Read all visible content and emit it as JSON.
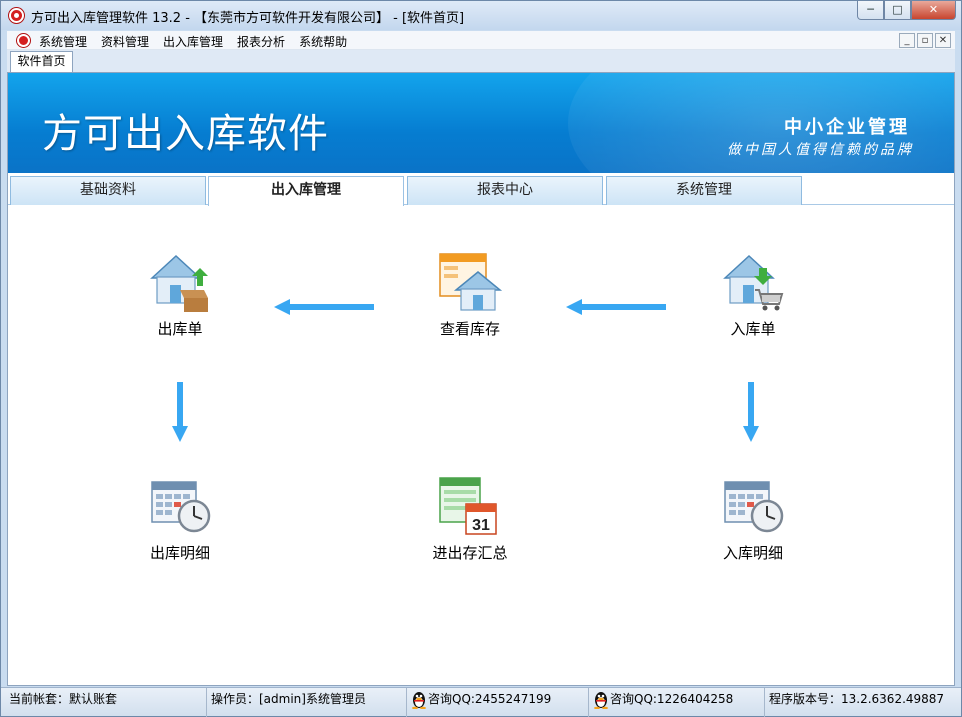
{
  "window": {
    "title": "方可出入库管理软件 13.2 - 【东莞市方可软件开发有限公司】 - [软件首页]",
    "buttons": [
      "─",
      "□",
      "✕"
    ]
  },
  "menubar": {
    "items": [
      "系统管理",
      "资料管理",
      "出入库管理",
      "报表分析",
      "系统帮助"
    ],
    "mdi_buttons": [
      "_",
      "▫",
      "✕"
    ]
  },
  "doc_tab": {
    "label": "软件首页"
  },
  "banner": {
    "title": "方可出入库软件",
    "subtitle": "中小企业管理",
    "slogan": "做中国人值得信赖的品牌"
  },
  "module_tabs": [
    {
      "label": "基础资料",
      "active": false
    },
    {
      "label": "出入库管理",
      "active": true
    },
    {
      "label": "报表中心",
      "active": false
    },
    {
      "label": "系统管理",
      "active": false
    }
  ],
  "tiles": {
    "outbound_order": {
      "label": "出库单",
      "icon": "house-box-icon"
    },
    "view_stock": {
      "label": "查看库存",
      "icon": "window-house-icon"
    },
    "inbound_order": {
      "label": "入库单",
      "icon": "house-cart-icon"
    },
    "outbound_detail": {
      "label": "出库明细",
      "icon": "calendar-clock-icon"
    },
    "summary": {
      "label": "进出存汇总",
      "icon": "calendar-31-icon",
      "day": "31"
    },
    "inbound_detail": {
      "label": "入库明细",
      "icon": "calendar-clock-icon"
    }
  },
  "statusbar": {
    "account": "当前帐套：默认账套",
    "operator": "操作员：[admin]系统管理员",
    "qq1": "咨询QQ:2455247199",
    "qq2": "咨询QQ:1226404258",
    "version": "程序版本号：13.2.6362.49887"
  },
  "colors": {
    "accent": "#38a7f2",
    "banner_blue": "#067dd1"
  }
}
